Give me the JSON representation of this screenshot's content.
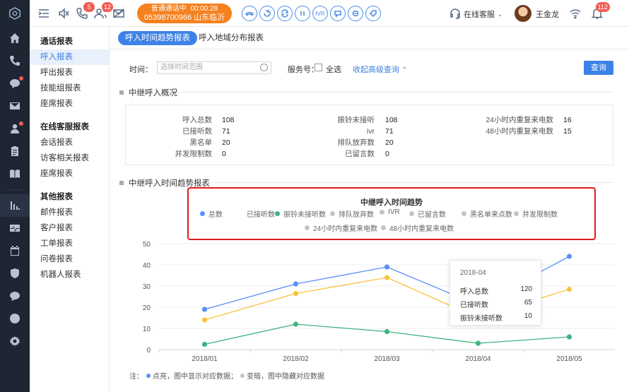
{
  "topbar": {
    "call_status": "普通通话中",
    "call_time": "00:00:28",
    "call_number": "05398700966",
    "call_location": "山东临沂",
    "badges": {
      "missed_calls": "5",
      "visitors": "12",
      "alerts": "112"
    },
    "ivr_label": "IVR",
    "online_service": "在线客服",
    "username": "王金龙"
  },
  "subnav": {
    "groups": [
      {
        "title": "通话报表",
        "items": [
          "呼入报表",
          "呼出报表",
          "技能组报表",
          "座席报表"
        ]
      },
      {
        "title": "在线客服报表",
        "items": [
          "会话报表",
          "访客相关报表",
          "座席报表"
        ]
      },
      {
        "title": "其他报表",
        "items": [
          "邮件报表",
          "客户报表",
          "工单报表",
          "问卷报表",
          "机器人报表"
        ]
      }
    ],
    "active_item": "呼入报表"
  },
  "tabs": [
    "呼入时间趋势报表",
    "呼入地域分布报表"
  ],
  "filters": {
    "time_label": "时间：",
    "time_placeholder": "选择时间范围",
    "service_label": "服务号：",
    "select_all": "全选",
    "advanced_toggle": "收起高级查询",
    "query_button": "查询"
  },
  "overview": {
    "title": "中继呼入概况",
    "col1": [
      {
        "label": "呼入总数",
        "value": "108"
      },
      {
        "label": "已接听数",
        "value": "71"
      },
      {
        "label": "黑名单",
        "value": "20"
      },
      {
        "label": "并发限制数",
        "value": "0"
      }
    ],
    "col2": [
      {
        "label": "振铃未接听",
        "value": "108"
      },
      {
        "label": "ivr",
        "value": "71"
      },
      {
        "label": "排队放弃数",
        "value": "20"
      },
      {
        "label": "已留言数",
        "value": "0"
      }
    ],
    "col3": [
      {
        "label": "24小时内重复来电数",
        "value": "16"
      },
      {
        "label": "48小时内重复来电数",
        "value": "15"
      }
    ]
  },
  "trend": {
    "section_title": "中继呼入时间趋势报表",
    "note_prefix": "注：",
    "note_on": "点亮，图中显示对应数据；",
    "note_off": "变暗，图中隐藏对应数据"
  },
  "chart_data": {
    "type": "line",
    "title": "中继呼入时间趋势",
    "categories": [
      "2018/01",
      "2018/02",
      "2018/03",
      "2018/04",
      "2018/05"
    ],
    "ylim": [
      0,
      50
    ],
    "yticks": [
      0,
      10,
      20,
      30,
      40,
      50
    ],
    "grid": true,
    "legend": [
      {
        "name": "总数",
        "color": "#5b8ff9",
        "active": true
      },
      {
        "name": "已接听数",
        "color": "#f9c33c",
        "active": true
      },
      {
        "name": "振铃未接听数",
        "color": "#3fb27f",
        "active": true
      },
      {
        "name": "排队放弃数",
        "color": "#c4c4c4",
        "active": false
      },
      {
        "name": "IVR",
        "color": "#c4c4c4",
        "active": false
      },
      {
        "name": "已留言数",
        "color": "#c4c4c4",
        "active": false
      },
      {
        "name": "黑名单来点数",
        "color": "#c4c4c4",
        "active": false
      },
      {
        "name": "并发限制数",
        "color": "#c4c4c4",
        "active": false
      },
      {
        "name": "24小时内重复来电数",
        "color": "#c4c4c4",
        "active": false
      },
      {
        "name": "48小时内重复来电数",
        "color": "#c4c4c4",
        "active": false
      }
    ],
    "series": [
      {
        "name": "总数",
        "color": "#5b8ff9",
        "values": [
          19,
          31,
          39,
          21,
          44
        ]
      },
      {
        "name": "已接听数",
        "color": "#f9c33c",
        "values": [
          14,
          26.5,
          34,
          15,
          28.5
        ]
      },
      {
        "name": "振铃未接听数",
        "color": "#3fb27f",
        "values": [
          2.5,
          12,
          8.5,
          3,
          6
        ]
      }
    ],
    "tooltip": {
      "header": "2018-04",
      "rows": [
        {
          "label": "呼入总数",
          "value": "120"
        },
        {
          "label": "已接听数",
          "value": "65"
        },
        {
          "label": "振铃未接听数",
          "value": "10"
        }
      ]
    }
  }
}
